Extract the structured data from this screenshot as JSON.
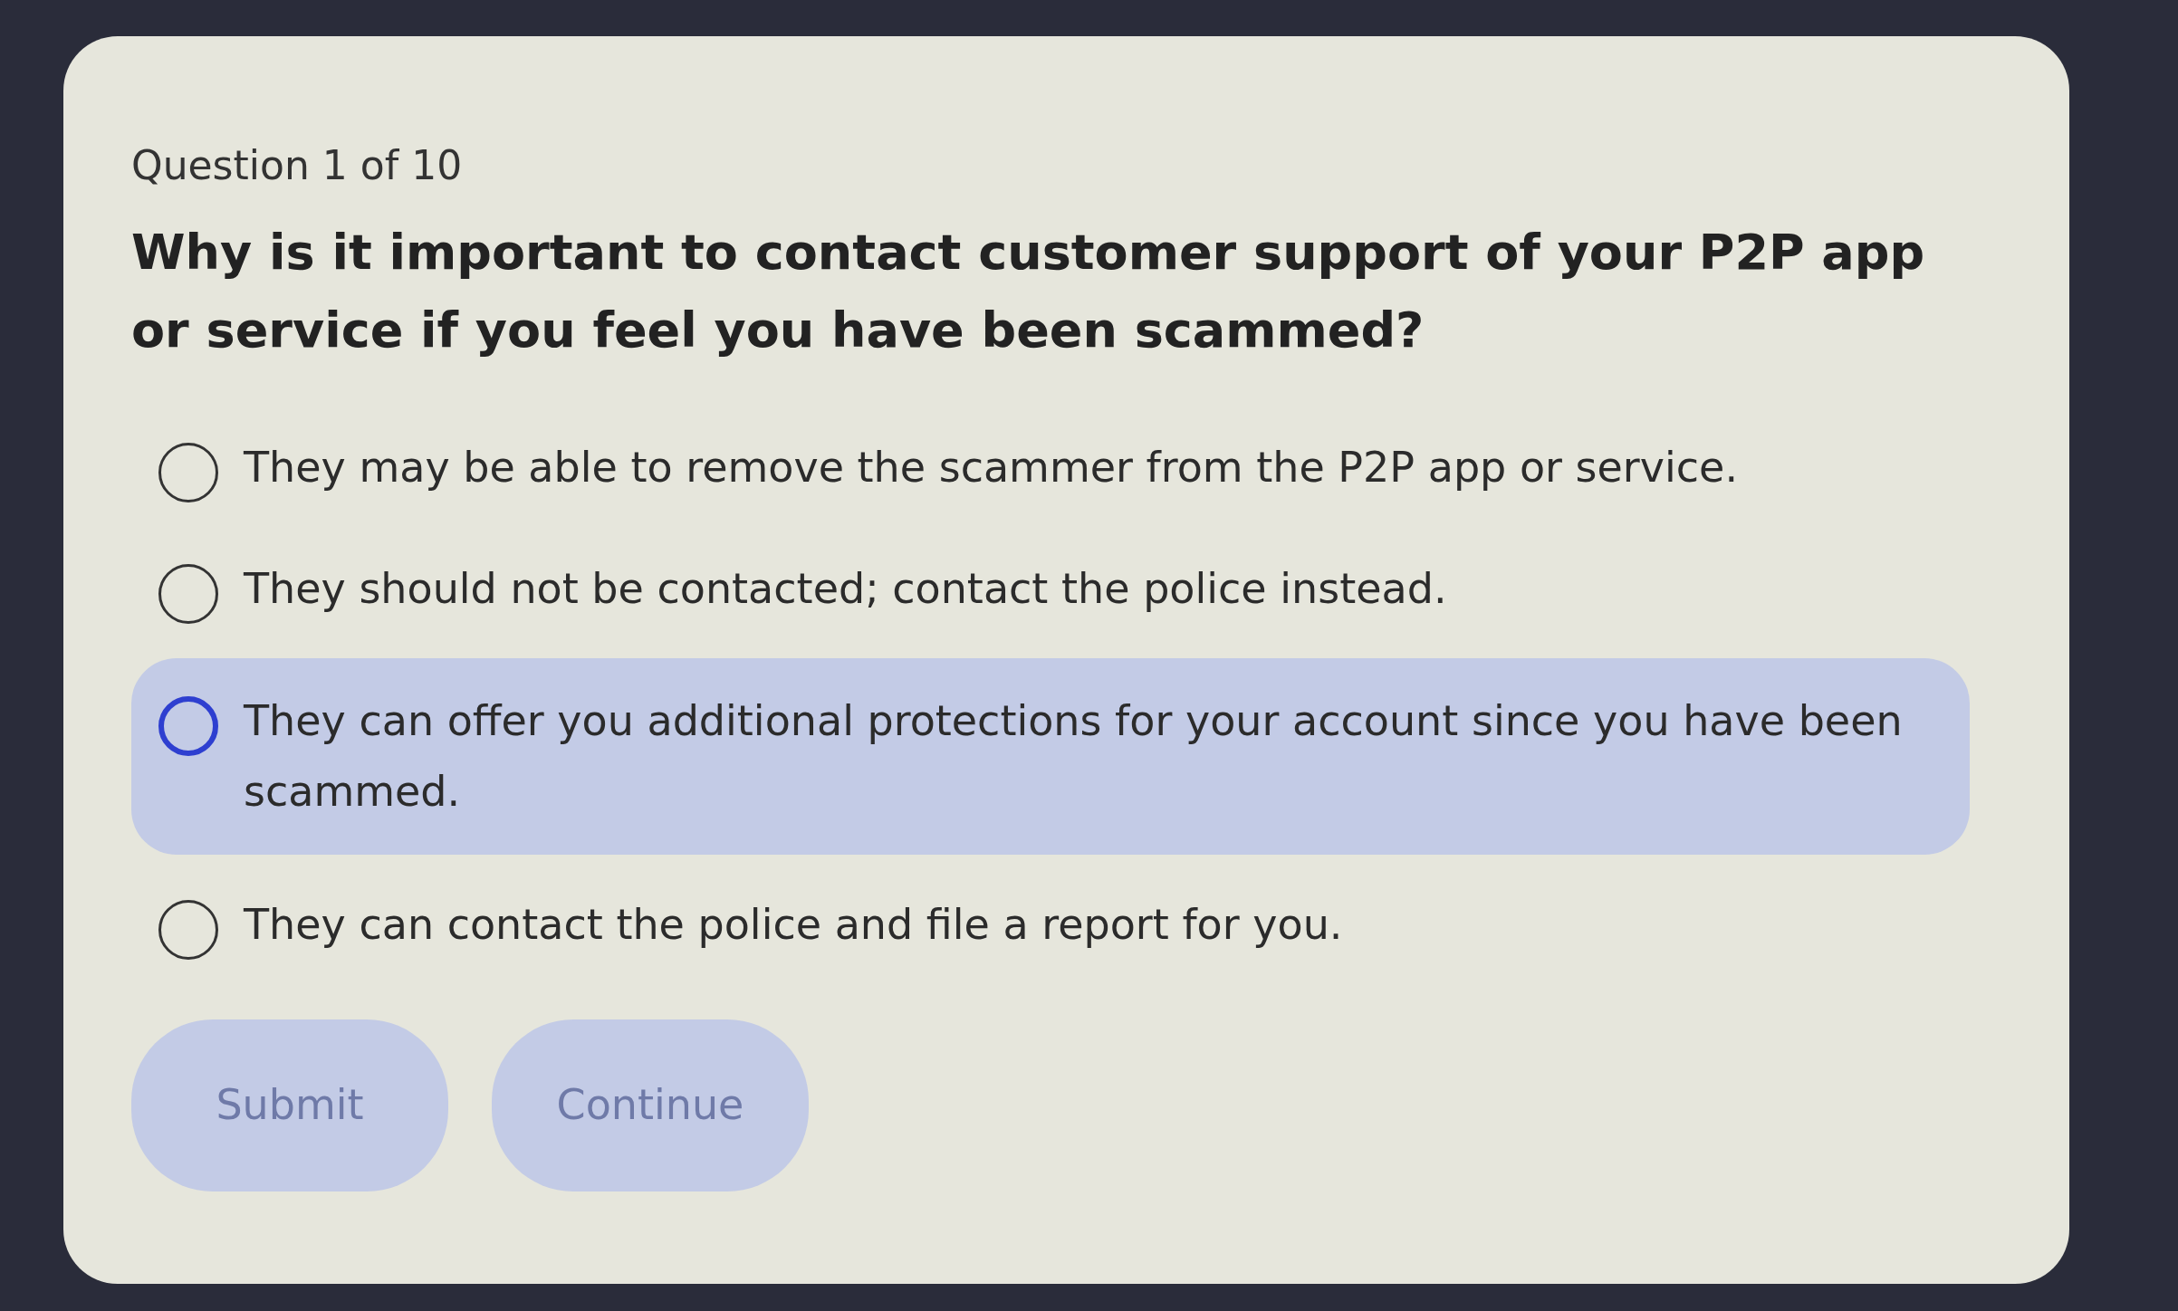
{
  "progress": "Question 1 of 10",
  "question": "Why is it important to contact customer support of your P2P app or service if you feel you have been scammed?",
  "options": [
    {
      "label": "They may be able to remove the scammer from the P2P app or service.",
      "selected": false,
      "highlighted": false
    },
    {
      "label": "They should not be contacted; contact the police instead.",
      "selected": false,
      "highlighted": false
    },
    {
      "label": "They can offer you additional protections for your account since you have been scammed.",
      "selected": false,
      "highlighted": true
    },
    {
      "label": "They can contact the police and file a report for you.",
      "selected": false,
      "highlighted": false
    }
  ],
  "buttons": [
    {
      "label": "Submit",
      "disabled": true
    },
    {
      "label": "Continue",
      "disabled": true
    }
  ]
}
